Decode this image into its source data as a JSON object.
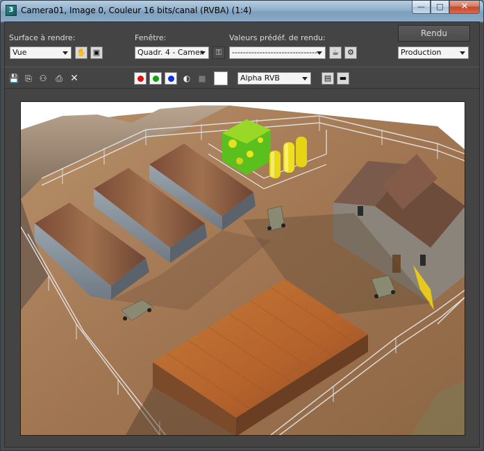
{
  "window": {
    "app_icon_glyph": "3",
    "title": "Camera01, Image 0, Couleur 16 bits/canal (RVBA) (1:4)",
    "minimize_glyph": "—",
    "maximize_glyph": "□",
    "close_glyph": "✕"
  },
  "controls": {
    "surface_label": "Surface à rendre:",
    "surface_value": "Vue",
    "window_label": "Fenêtre:",
    "window_value": "Quadr. 4 - Camer",
    "presets_label": "Valeurs prédéf. de rendu:",
    "presets_value": "--------------------------------",
    "render_button": "Rendu",
    "production_value": "Production"
  },
  "toolbar": {
    "channel_value": "Alpha RVB",
    "colors": {
      "red": "#e01010",
      "green": "#10a010",
      "blue": "#1030e0"
    }
  },
  "icons": {
    "pick_region": "✋",
    "crop": "▣",
    "lock": "⚿",
    "teapot": "☕",
    "settings": "⚙",
    "save": "💾",
    "copy": "⎘",
    "clone": "⚇",
    "print": "⎙",
    "clear": "✕",
    "mono": "◐",
    "toggle": "■",
    "panel_a": "▤",
    "panel_b": "▬"
  }
}
